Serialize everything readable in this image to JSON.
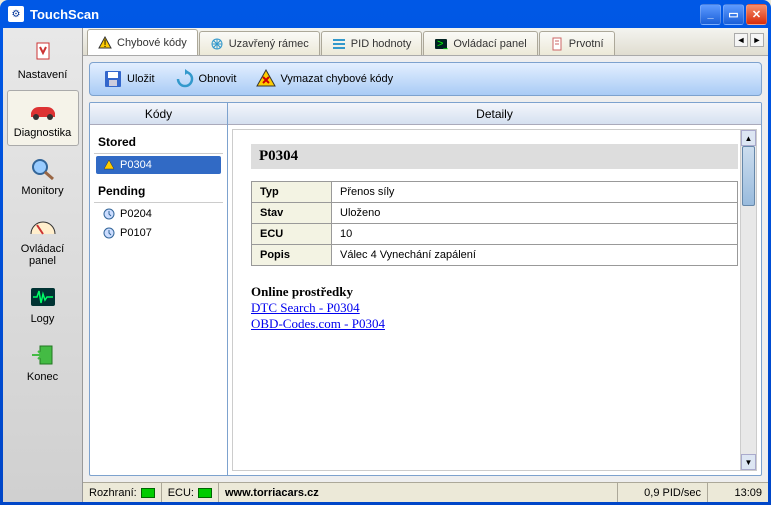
{
  "window": {
    "title": "TouchScan"
  },
  "sidebar": [
    {
      "id": "settings",
      "label": "Nastavení"
    },
    {
      "id": "diagnostics",
      "label": "Diagnostika"
    },
    {
      "id": "monitors",
      "label": "Monitory"
    },
    {
      "id": "control",
      "label": "Ovládací panel"
    },
    {
      "id": "logs",
      "label": "Logy"
    },
    {
      "id": "exit",
      "label": "Konec"
    }
  ],
  "tabs": [
    {
      "id": "errors",
      "label": "Chybové kódy"
    },
    {
      "id": "freeze",
      "label": "Uzavřený rámec"
    },
    {
      "id": "pid",
      "label": "PID hodnoty"
    },
    {
      "id": "control",
      "label": "Ovládací panel"
    },
    {
      "id": "first",
      "label": "Prvotní"
    }
  ],
  "toolbar": {
    "save": "Uložit",
    "refresh": "Obnovit",
    "clear": "Vymazat chybové kódy"
  },
  "columns": {
    "codes": "Kódy",
    "details": "Detaily"
  },
  "codes": {
    "stored": {
      "head": "Stored",
      "items": [
        "P0304"
      ]
    },
    "pending": {
      "head": "Pending",
      "items": [
        "P0204",
        "P0107"
      ]
    }
  },
  "detail": {
    "title": "P0304",
    "rows": {
      "typ": {
        "label": "Typ",
        "value": "Přenos síly"
      },
      "stav": {
        "label": "Stav",
        "value": "Uloženo"
      },
      "ecu": {
        "label": "ECU",
        "value": "10"
      },
      "popis": {
        "label": "Popis",
        "value": "Válec 4 Vynechání zapálení"
      }
    },
    "online_head": "Online prostředky",
    "links": [
      "DTC Search - P0304",
      "OBD-Codes.com - P0304"
    ]
  },
  "statusbar": {
    "interface": "Rozhraní:",
    "ecu": "ECU:",
    "url": "www.torriacars.cz",
    "pid": "0,9 PID/sec",
    "time": "13:09"
  }
}
